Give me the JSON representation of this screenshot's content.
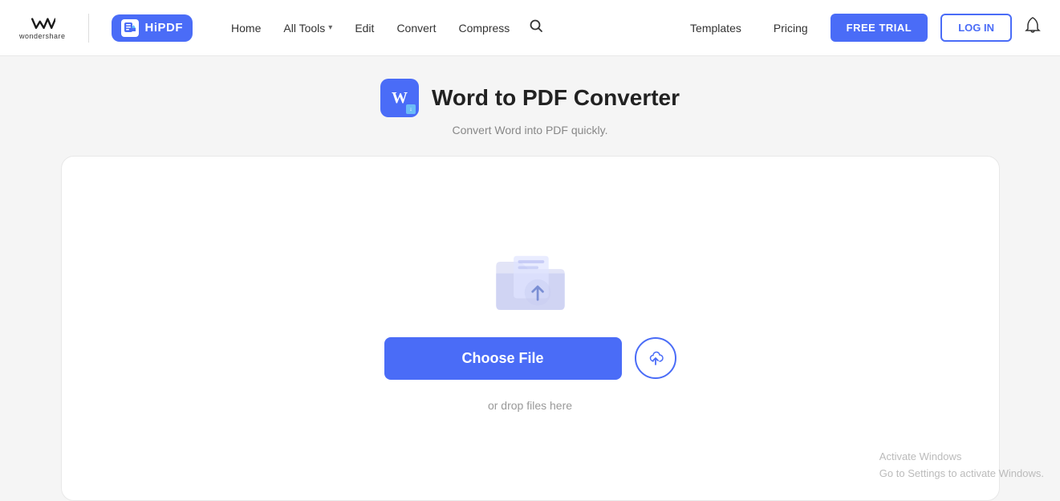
{
  "header": {
    "wondershare_text": "wondershare",
    "hipdf_label": "HiPDF",
    "nav": {
      "home": "Home",
      "all_tools": "All Tools",
      "edit": "Edit",
      "convert": "Convert",
      "compress": "Compress"
    },
    "right_nav": {
      "templates": "Templates",
      "pricing": "Pricing"
    },
    "free_trial_label": "FREE TRIAL",
    "login_label": "LOG IN"
  },
  "page": {
    "title": "Word to PDF Converter",
    "subtitle": "Convert Word into PDF quickly."
  },
  "upload": {
    "choose_file_label": "Choose File",
    "drop_text": "or drop files here"
  },
  "watermark": {
    "line1": "Activate Windows",
    "line2": "Go to Settings to activate Windows."
  }
}
